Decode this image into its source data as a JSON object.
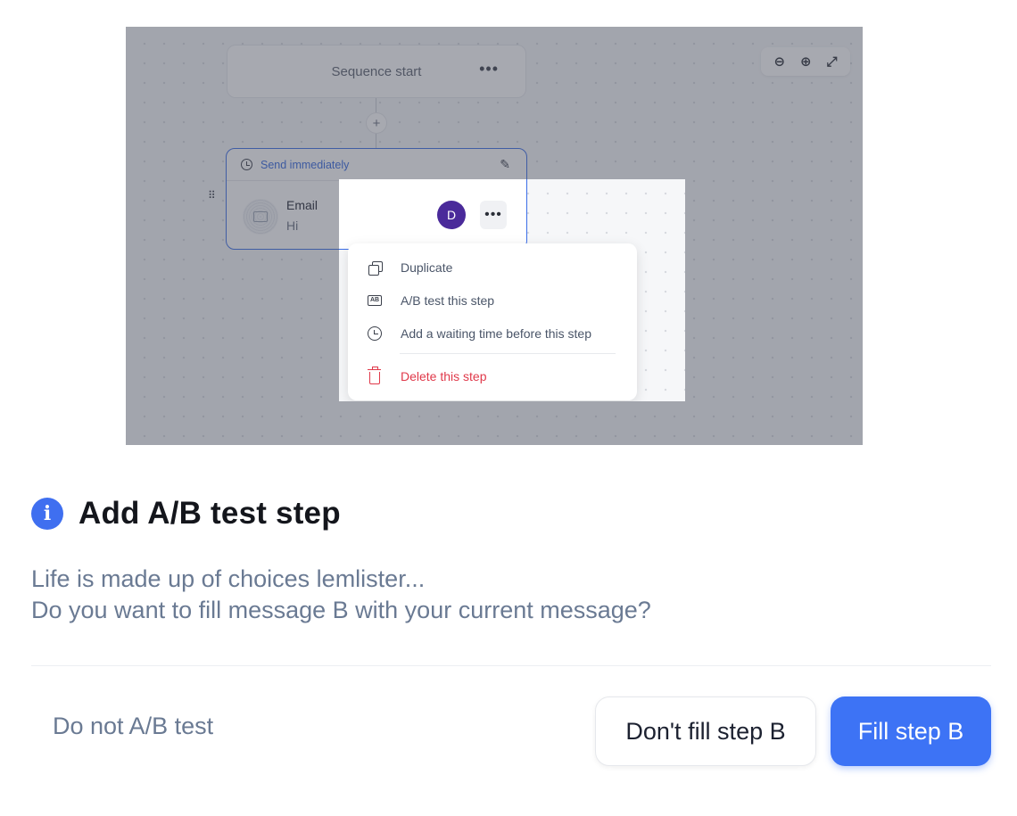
{
  "illustration": {
    "sequence_start_label": "Sequence start",
    "more_label": "•••",
    "add_step_label": "+",
    "email_step": {
      "timing_label": "Send immediately",
      "title": "Email",
      "subtitle": "Hi"
    },
    "user_avatar_initial": "D",
    "context_menu": {
      "items": [
        {
          "label": "Duplicate",
          "icon": "duplicate-icon"
        },
        {
          "label": "A/B test this step",
          "icon": "ab-test-icon"
        },
        {
          "label": "Add a waiting time before this step",
          "icon": "clock-icon"
        }
      ],
      "danger_item": {
        "label": "Delete this step",
        "icon": "trash-icon"
      }
    },
    "zoom_controls": [
      "zoom-out-icon",
      "zoom-in-icon",
      "expand-icon"
    ]
  },
  "dialog": {
    "title": "Add A/B test step",
    "body_line1": "Life is made up of choices lemlister...",
    "body_line2": "Do you want to fill message B with your current message?",
    "buttons": {
      "cancel": "Do not A/B test",
      "secondary": "Don't fill step B",
      "primary": "Fill step B"
    }
  },
  "colors": {
    "accent": "#3d73f5",
    "danger": "#e0394a",
    "avatar": "#4a2a9a",
    "muted_text": "#6a7a93"
  }
}
